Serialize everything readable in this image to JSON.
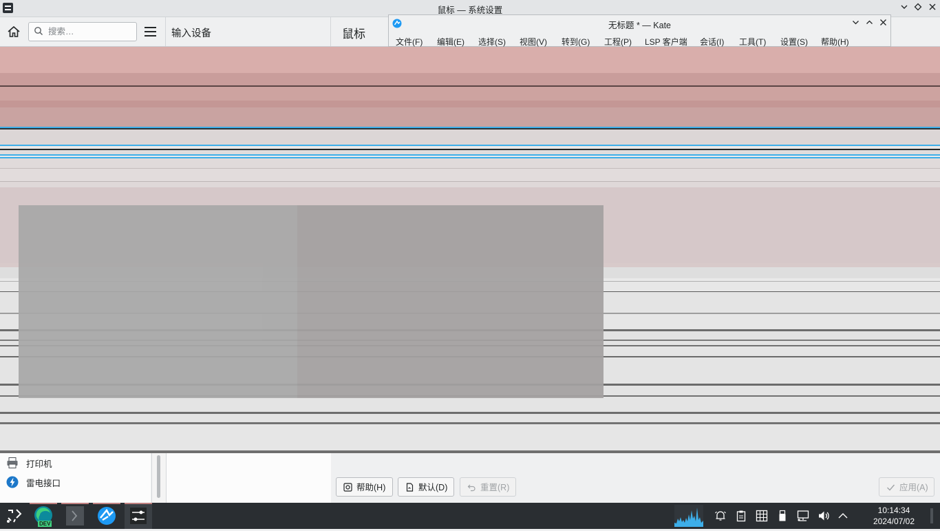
{
  "window": {
    "title": "鼠标 — 系统设置",
    "controls": [
      "minimize",
      "maximize",
      "close"
    ]
  },
  "toolbar": {
    "search_placeholder": "搜索…",
    "breadcrumb_category": "输入设备",
    "page_title": "鼠标"
  },
  "sidebar": {
    "items": [
      {
        "label": "打印机",
        "icon": "printer-icon"
      },
      {
        "label": "雷电接口",
        "icon": "thunderbolt-icon"
      }
    ]
  },
  "footer": {
    "help_label": "帮助(H)",
    "defaults_label": "默认(D)",
    "reset_label": "重置(R)",
    "apply_label": "应用(A)"
  },
  "kate": {
    "title": "无标题 * — Kate",
    "menu": [
      "文件(F)",
      "编辑(E)",
      "选择(S)",
      "视图(V)",
      "转到(G)",
      "工程(P)",
      "LSP 客户端",
      "会话(I)",
      "工具(T)",
      "设置(S)",
      "帮助(H)"
    ]
  },
  "taskbar": {
    "apps": [
      "application-launcher",
      "edge-dev-browser",
      "konsole-terminal",
      "kate-editor",
      "system-settings"
    ],
    "edge_badge": "DEV",
    "tray_icons": [
      "system-monitor",
      "notifications-icon",
      "clipboard-icon",
      "keyboard-layout-icon",
      "usb-device-icon",
      "network-icon",
      "volume-icon",
      "expand-tray-icon"
    ],
    "time": "10:14:34",
    "date": "2024/07/02"
  },
  "colors": {
    "accent": "#3daee9",
    "taskbar_bg": "#2a2e32",
    "window_bg": "#eff0f1"
  }
}
